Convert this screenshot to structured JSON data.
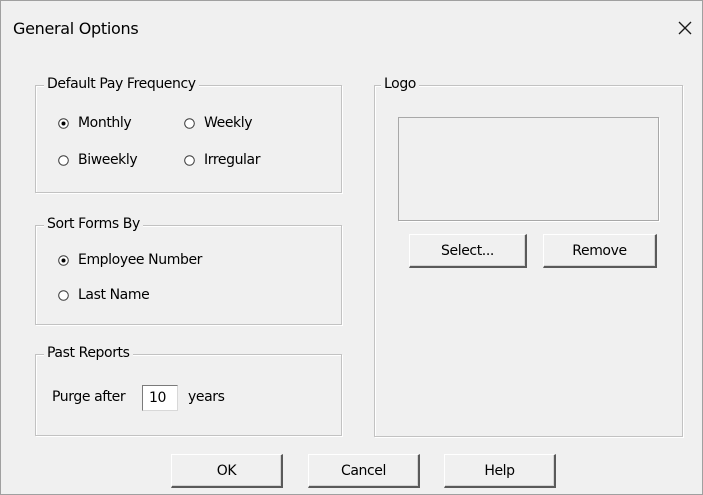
{
  "dialog": {
    "title": "General Options"
  },
  "pay_frequency": {
    "legend": "Default Pay Frequency",
    "options": [
      {
        "label": "Monthly",
        "selected": true
      },
      {
        "label": "Weekly",
        "selected": false
      },
      {
        "label": "Biweekly",
        "selected": false
      },
      {
        "label": "Irregular",
        "selected": false
      }
    ]
  },
  "sort_forms": {
    "legend": "Sort Forms By",
    "options": [
      {
        "label": "Employee Number",
        "selected": true
      },
      {
        "label": "Last Name",
        "selected": false
      }
    ]
  },
  "past_reports": {
    "legend": "Past Reports",
    "purge_prefix": "Purge after",
    "purge_value": "10",
    "purge_suffix": "years"
  },
  "logo": {
    "legend": "Logo",
    "select_label": "Select...",
    "remove_label": "Remove"
  },
  "footer": {
    "ok_label": "OK",
    "cancel_label": "Cancel",
    "help_label": "Help"
  }
}
